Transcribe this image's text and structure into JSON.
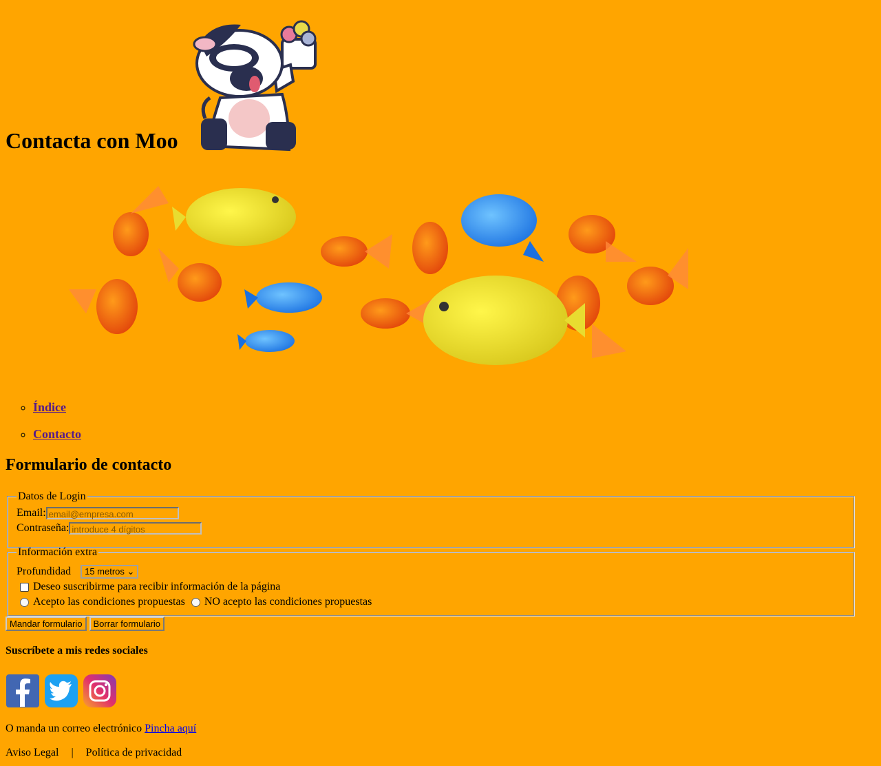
{
  "header": {
    "title": "Contacta con Moo"
  },
  "nav": {
    "items": [
      {
        "label": "Índice"
      },
      {
        "label": "Contacto"
      }
    ]
  },
  "form": {
    "title": "Formulario de contacto",
    "login": {
      "legend": "Datos de Login",
      "email_label": "Email:",
      "email_placeholder": "email@empresa.com",
      "password_label": "Contraseña:",
      "password_placeholder": "introduce 4 dígitos"
    },
    "extra": {
      "legend": "Información extra",
      "depth_label": "Profundidad",
      "depth_value": "15 metros",
      "subscribe_label": "Deseo suscribirme para recibir información de la página",
      "accept_label": "Acepto las condiciones propuestas",
      "reject_label": "NO acepto las condiciones propuestas"
    },
    "submit_label": "Mandar formulario",
    "reset_label": "Borrar formulario"
  },
  "social": {
    "title": "Suscríbete a mis redes sociales",
    "icons": [
      "facebook-icon",
      "twitter-icon",
      "instagram-icon"
    ],
    "colors": {
      "facebook": "#4267b2",
      "twitter": "#1da1f2",
      "instagram": "#c13584"
    }
  },
  "mail": {
    "text": "O manda un correo electrónico ",
    "link": "Pincha aquí"
  },
  "footer": {
    "legal": "Aviso Legal",
    "separator": "|",
    "privacy": "Política de privacidad"
  },
  "colors": {
    "background": "#ffa500",
    "visited_link": "#551a8b",
    "link": "#0000ee"
  }
}
